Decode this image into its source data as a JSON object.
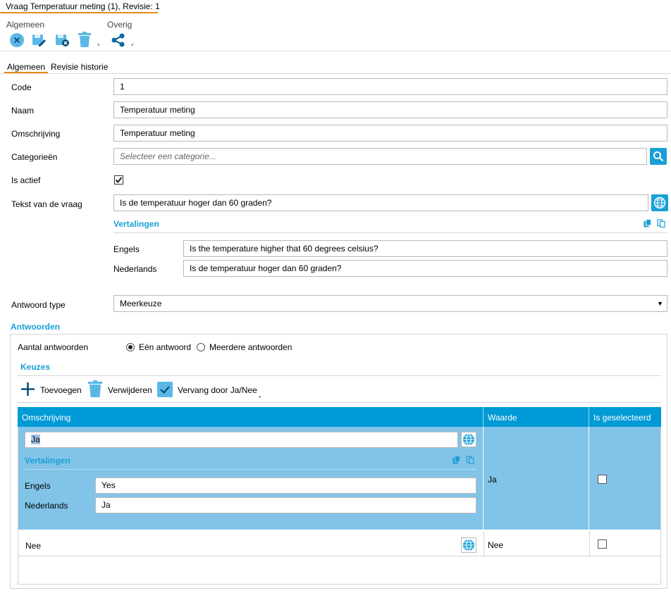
{
  "window": {
    "title": "Vraag Temperatuur meting (1), Revisie: 1"
  },
  "ribbon": {
    "group_general": "Algemeen",
    "group_other": "Overig",
    "icons": [
      "close-circle-icon",
      "save-edit-icon",
      "save-close-icon",
      "trash-icon",
      "share-icon"
    ]
  },
  "tabs": [
    {
      "label": "Algemeen",
      "active": true
    },
    {
      "label": "Revisie historie",
      "active": false
    }
  ],
  "form": {
    "code": {
      "label": "Code",
      "value": "1"
    },
    "name": {
      "label": "Naam",
      "value": "Temperatuur meting"
    },
    "description": {
      "label": "Omschrijving",
      "value": "Temperatuur meting"
    },
    "categories": {
      "label": "Categorieën",
      "placeholder": "Selecteer een categorie..."
    },
    "active": {
      "label": "Is actief",
      "checked": true
    },
    "question": {
      "label": "Tekst van de vraag",
      "value": "Is de temperatuur hoger dan 60 graden?",
      "translations_title": "Vertalingen",
      "translations": [
        {
          "language": "Engels",
          "value": "Is the temperature higher that 60 degrees celsius?"
        },
        {
          "language": "Nederlands",
          "value": "Is de temperatuur hoger dan 60 graden?"
        }
      ]
    },
    "answer_type": {
      "label": "Antwoord type",
      "value": "Meerkeuze"
    }
  },
  "answers": {
    "title": "Antwoorden",
    "count_label": "Aantal antwoorden",
    "radio_single": "Eén antwoord",
    "radio_multiple": "Meerdere antwoorden",
    "selected": "single",
    "choices_title": "Keuzes",
    "toolbar": {
      "add": "Toevoegen",
      "delete": "Verwijderen",
      "replace": "Vervang door Ja/Nee"
    },
    "columns": [
      "Omschrijving",
      "Waarde",
      "Is geselecteerd"
    ],
    "rows": [
      {
        "description": "Ja",
        "value": "Ja",
        "selected": false,
        "translations_title": "Vertalingen",
        "translations": [
          {
            "language": "Engels",
            "value": "Yes"
          },
          {
            "language": "Nederlands",
            "value": "Ja"
          }
        ]
      },
      {
        "description": "Nee",
        "value": "Nee",
        "selected": false
      }
    ]
  },
  "colors": {
    "accent": "#1a9fd7",
    "header": "#009ad6",
    "selected_row": "#82c4e8",
    "tab_underline": "#e8891d"
  }
}
